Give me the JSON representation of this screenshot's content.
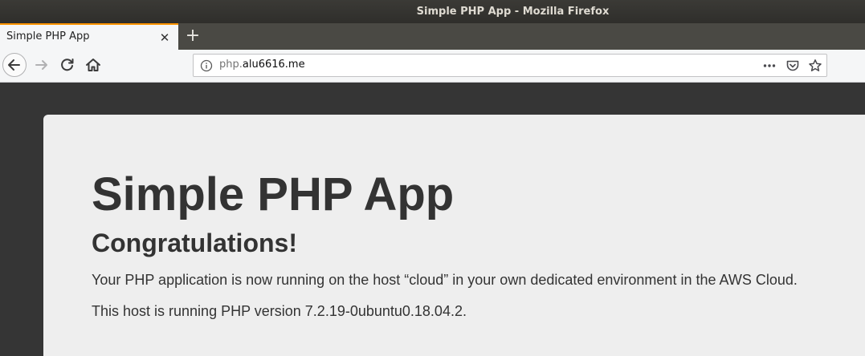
{
  "window": {
    "title": "Simple PHP App - Mozilla Firefox"
  },
  "tabs": [
    {
      "label": "Simple PHP App",
      "close_glyph": "✕",
      "active": true
    }
  ],
  "newtab_glyph": "+",
  "urlbar": {
    "host_sub": "php.",
    "host_domain": "alu6616.me",
    "actions": [
      "page-actions-icon",
      "pocket-icon",
      "bookmark-star-icon"
    ]
  },
  "page": {
    "heading": "Simple PHP App",
    "subheading": "Congratulations!",
    "paragraph1": "Your PHP application is now running on the host “cloud” in your own dedicated environment in the AWS Cloud.",
    "paragraph2": "This host is running PHP version 7.2.19-0ubuntu0.18.04.2."
  },
  "colors": {
    "tab_accent": "#ff9400",
    "titlebar": "#3b3a36",
    "page_background": "#353535",
    "card_background": "#eeeeee",
    "text": "#333333"
  }
}
